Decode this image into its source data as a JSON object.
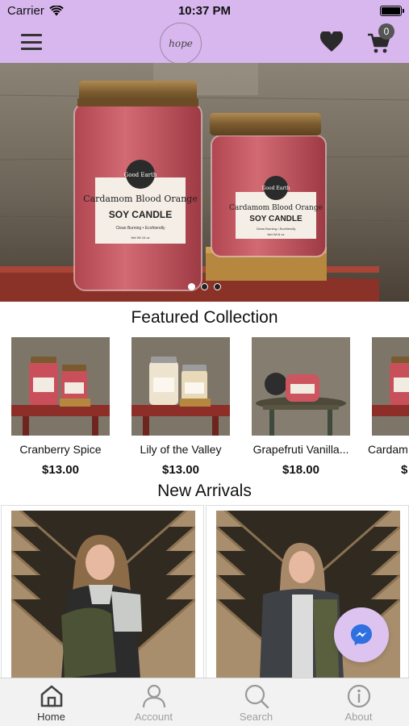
{
  "status_bar": {
    "carrier": "Carrier",
    "time": "10:37 PM"
  },
  "header": {
    "logo_text": "hope",
    "cart_count": "0"
  },
  "hero": {
    "slide_count": 3,
    "active_slide": 1,
    "jar_labels": [
      {
        "brand": "Good Earth",
        "title": "Cardamom Blood Orange",
        "subtitle": "SOY CANDLE",
        "tagline": "Clean Burning • Ecofriendly",
        "weight": "Net Wt 16 oz"
      },
      {
        "brand": "Good Earth",
        "title": "Cardamom Blood Orange",
        "subtitle": "SOY CANDLE",
        "tagline": "Clean Burning • Ecofriendly",
        "weight": "Net Wt 8 oz"
      }
    ]
  },
  "featured": {
    "title": "Featured Collection",
    "items": [
      {
        "name": "Cranberry Spice",
        "price": "$13.00",
        "wax": "#c9505b"
      },
      {
        "name": "Lily of the Valley",
        "price": "$13.00",
        "wax": "#ede3cf"
      },
      {
        "name": "Grapefruti Vanilla...",
        "price": "$18.00",
        "wax": "#cc5560"
      },
      {
        "name": "Cardam",
        "price": "$",
        "wax": "#c8505b"
      }
    ]
  },
  "arrivals": {
    "title": "New Arrivals"
  },
  "tabs": [
    {
      "label": "Home",
      "icon": "home-icon",
      "active": true
    },
    {
      "label": "Account",
      "icon": "person-icon",
      "active": false
    },
    {
      "label": "Search",
      "icon": "search-icon",
      "active": false
    },
    {
      "label": "About",
      "icon": "info-icon",
      "active": false
    }
  ],
  "colors": {
    "header_bg": "#d8b6ee",
    "messenger_fab": "#dcc3f0",
    "messenger_blue": "#2f6fe0"
  }
}
